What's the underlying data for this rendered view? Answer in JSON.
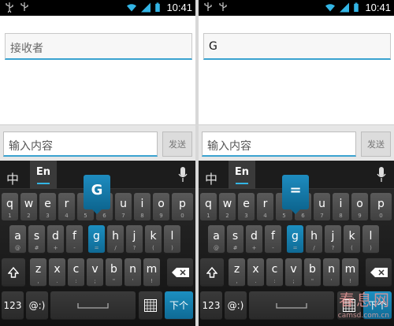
{
  "status_bar": {
    "time": "10:41"
  },
  "left": {
    "to_field": {
      "value": "",
      "placeholder": "接收者"
    },
    "message_input": {
      "placeholder": "输入内容"
    },
    "send_label": "发送",
    "popup_key": "G"
  },
  "right": {
    "to_field": {
      "value": "G",
      "placeholder": ""
    },
    "message_input": {
      "placeholder": "输入内容"
    },
    "send_label": "发送",
    "popup_key": "="
  },
  "keyboard": {
    "lang_zh": "中",
    "lang_en": "En",
    "row1": [
      {
        "k": "q",
        "s": "1"
      },
      {
        "k": "w",
        "s": "2"
      },
      {
        "k": "e",
        "s": "3"
      },
      {
        "k": "r",
        "s": "4"
      },
      {
        "k": "t",
        "s": "5"
      },
      {
        "k": "y",
        "s": "6"
      },
      {
        "k": "u",
        "s": "7"
      },
      {
        "k": "i",
        "s": "8"
      },
      {
        "k": "o",
        "s": "9"
      },
      {
        "k": "p",
        "s": "0"
      }
    ],
    "row2": [
      {
        "k": "a",
        "s": "@"
      },
      {
        "k": "s",
        "s": "#"
      },
      {
        "k": "d",
        "s": "+"
      },
      {
        "k": "f",
        "s": "-"
      },
      {
        "k": "g",
        "s": "="
      },
      {
        "k": "h",
        "s": "/"
      },
      {
        "k": "j",
        "s": "?"
      },
      {
        "k": "k",
        "s": "("
      },
      {
        "k": "l",
        "s": ")"
      }
    ],
    "row3": [
      {
        "k": "z",
        "s": ","
      },
      {
        "k": "x",
        "s": "."
      },
      {
        "k": "c",
        "s": ":"
      },
      {
        "k": "v",
        "s": ";"
      },
      {
        "k": "b",
        "s": "\""
      },
      {
        "k": "n",
        "s": "'"
      },
      {
        "k": "m",
        "s": "!"
      }
    ],
    "numbers_label": "123",
    "emoji_label": "@:)",
    "enter_label": "下个"
  },
  "watermark": {
    "text": "春息网",
    "url": "camsd.com.cn"
  },
  "icons": {
    "usb": "usb-icon",
    "wifi": "wifi-icon",
    "signal": "signal-icon",
    "battery": "battery-icon",
    "mic": "mic-icon",
    "shift": "shift-icon",
    "backspace": "backspace-icon",
    "grid": "keyboard-grid-icon"
  },
  "colors": {
    "accent": "#33b5e5",
    "key_active": "#1c8fc0",
    "keyboard_bg": "#1c1c1c"
  }
}
